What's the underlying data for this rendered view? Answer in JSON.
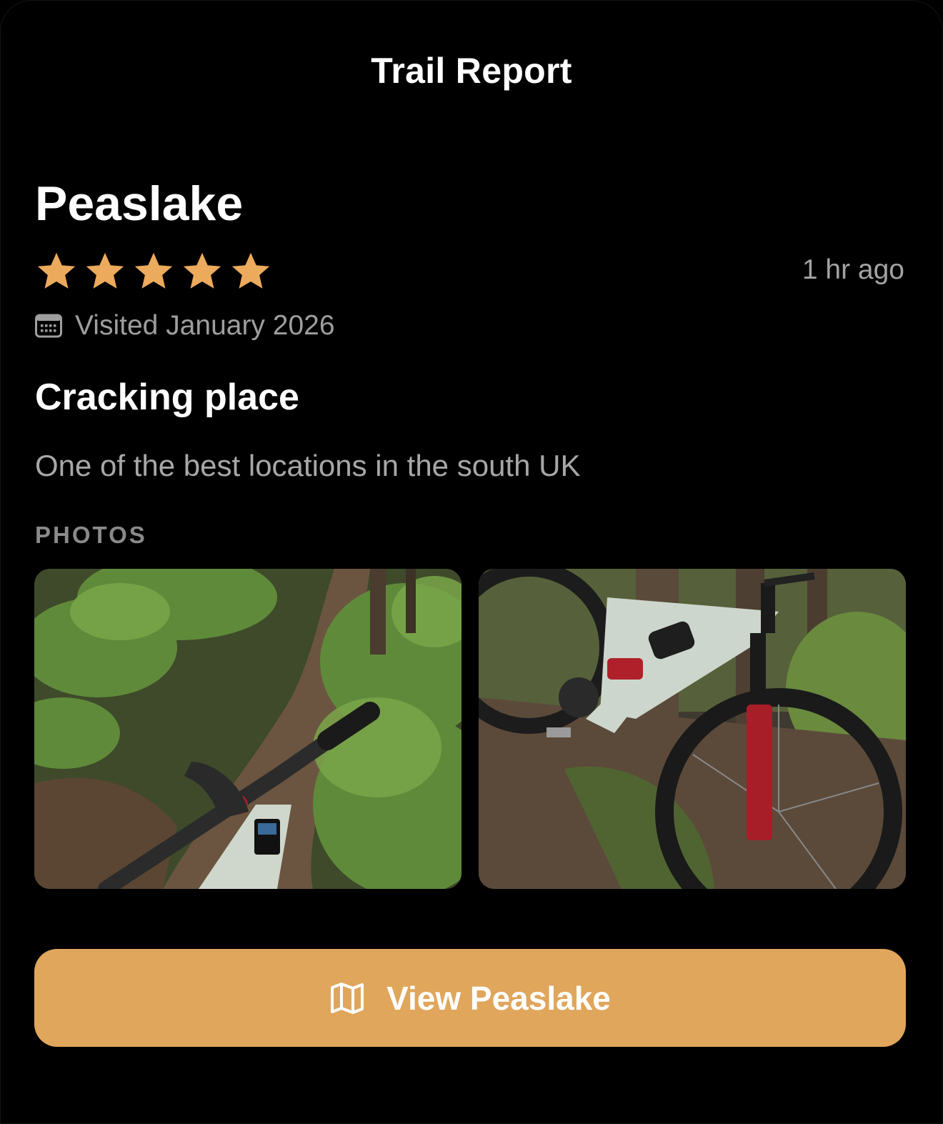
{
  "header": {
    "title": "Trail Report"
  },
  "review": {
    "location_name": "Peaslake",
    "rating": 5,
    "rating_max": 5,
    "star_color": "#ebaa5c",
    "time_ago": "1 hr ago",
    "visited_icon": "calendar-icon",
    "visited_text": "Visited January 2026",
    "title": "Cracking place",
    "body": "One of the best locations in the south UK"
  },
  "photos": {
    "section_label": "PHOTOS",
    "items": [
      {
        "subject": "handlebar-trail-photo"
      },
      {
        "subject": "bike-frame-photo"
      }
    ]
  },
  "action": {
    "icon": "map-icon",
    "label": "View Peaslake",
    "color": "#e0a65c"
  }
}
